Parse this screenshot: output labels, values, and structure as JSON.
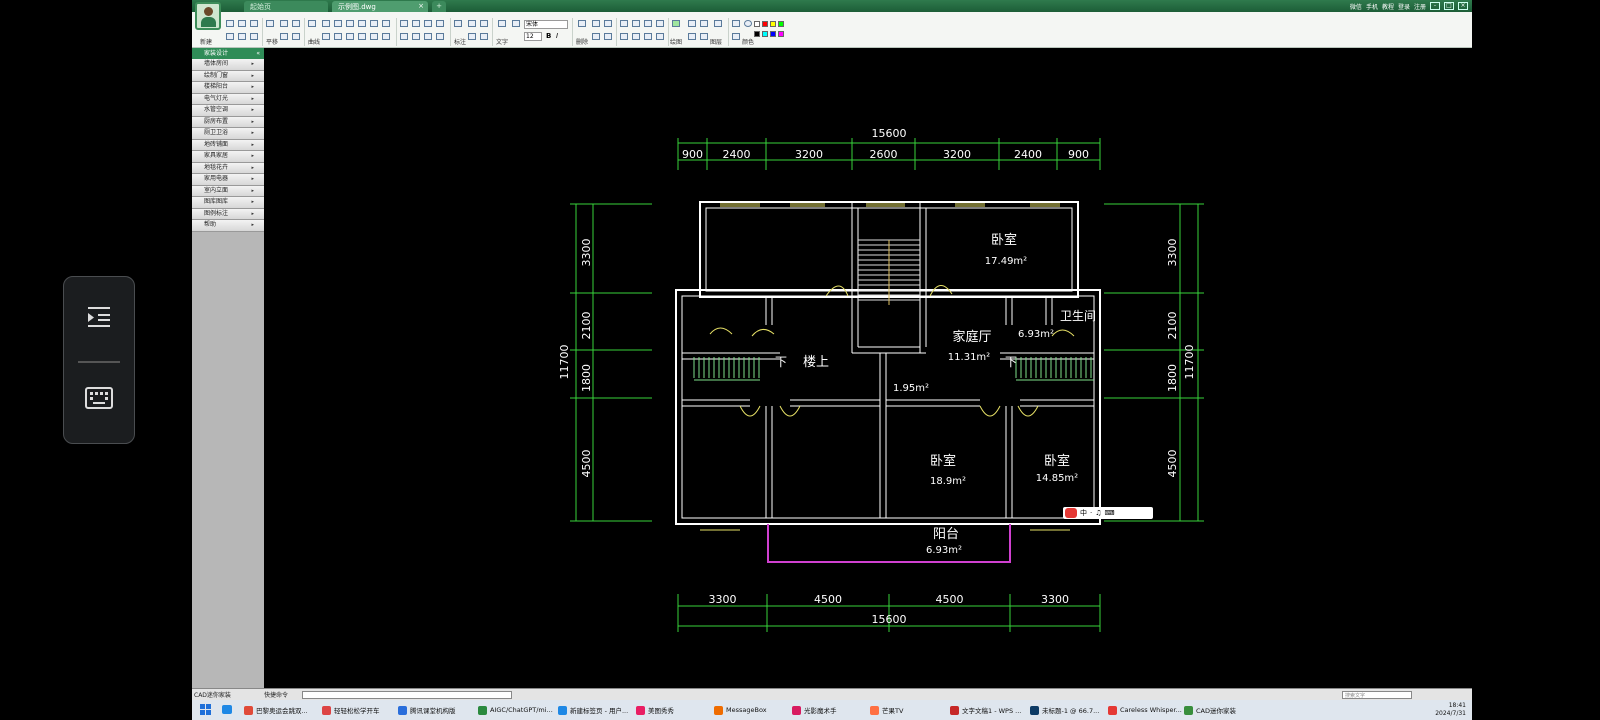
{
  "titlebar": {
    "tab_start": "起始页",
    "tab_file": "示例图.dwg",
    "tab_close": "×",
    "tab_add": "+",
    "right_items": [
      "微信",
      "手机",
      "教程",
      "登录",
      "注册"
    ],
    "win_min": "-",
    "win_max": "□",
    "win_close": "×"
  },
  "ribbon": {
    "new_label": "新建",
    "move_label": "平移",
    "curve_label": "曲线",
    "dim_label": "标注",
    "text_label": "文字",
    "erase_label": "删除",
    "draw_label": "绘图",
    "layer_label": "图层",
    "color_label": "颜色",
    "font_value": "宋体",
    "size_value": "12",
    "bold": "B",
    "italic": "I",
    "colors": [
      "#ffffff",
      "#ff0000",
      "#ffff00",
      "#00ff00",
      "#000000",
      "#00ffff",
      "#0000ff",
      "#ff00ff"
    ]
  },
  "sidebar": {
    "header": "家装设计",
    "header_collapse": "«",
    "items": [
      {
        "label": "墙体房间",
        "arrow": "▸"
      },
      {
        "label": "绘制门窗",
        "arrow": "▸"
      },
      {
        "label": "楼梯阳台",
        "arrow": "▸"
      },
      {
        "label": "电气灯光",
        "arrow": "▸"
      },
      {
        "label": "水管空调",
        "arrow": "▸"
      },
      {
        "label": "厨房布置",
        "arrow": "▸"
      },
      {
        "label": "厕卫卫浴",
        "arrow": "▸"
      },
      {
        "label": "地砖铺面",
        "arrow": "▸"
      },
      {
        "label": "家具家居",
        "arrow": "▸"
      },
      {
        "label": "地毯花卉",
        "arrow": "▸"
      },
      {
        "label": "家用电器",
        "arrow": "▸"
      },
      {
        "label": "室内立面",
        "arrow": "▸"
      },
      {
        "label": "图库图库",
        "arrow": "▸"
      },
      {
        "label": "图例标注",
        "arrow": "▸"
      },
      {
        "label": "帮助",
        "arrow": "▸"
      }
    ]
  },
  "drawing": {
    "dims_top_total": "15600",
    "dims_top": [
      "900",
      "2400",
      "3200",
      "2600",
      "3200",
      "2400",
      "900"
    ],
    "dims_bottom": [
      "3300",
      "4500",
      "4500",
      "3300"
    ],
    "dims_bottom_total": "15600",
    "dims_left_total": "11700",
    "dims_left": [
      "3300",
      "2100",
      "1800",
      "4500"
    ],
    "dims_right": [
      "3300",
      "2100",
      "1800",
      "4500"
    ],
    "dims_right_total": "11700",
    "rooms": {
      "bed_ne": "卧室",
      "bed_ne_area": "17.49m²",
      "family": "家庭厅",
      "family_area": "11.31m²",
      "bath": "卫生间",
      "bath_area": "6.93m²",
      "stair_down_left": "下",
      "stair_up": "楼上",
      "stair_down_right": "下",
      "small_area": "1.95m²",
      "bed_sc": "卧室",
      "bed_sc_area": "18.9m²",
      "bed_se": "卧室",
      "bed_se_area": "14.85m²",
      "balcony": "阳台",
      "balcony_area": "6.93m²"
    }
  },
  "cmdbar": {
    "name": "CAD迷你家装",
    "label": "快捷命令",
    "search_placeholder": "搜索文字"
  },
  "ime": {
    "items": [
      "中",
      "·",
      "♫",
      "⌨"
    ]
  },
  "taskbar": {
    "tasks": [
      {
        "label": "巴黎奥运会跳双...",
        "color": "#e04b3a"
      },
      {
        "label": "轻轻松松学开车",
        "color": "#d44"
      },
      {
        "label": "腾讯课堂机构版",
        "color": "#2a6edb"
      },
      {
        "label": "AIGC/ChatGPT/mi...",
        "color": "#2b8a3e"
      },
      {
        "label": "新建标签页 - 用户...",
        "color": "#1e88e5"
      },
      {
        "label": "美图秀秀",
        "color": "#e91e63"
      },
      {
        "label": "MessageBox",
        "color": "#ef6c00"
      },
      {
        "label": "光影魔术手",
        "color": "#d81b60"
      },
      {
        "label": "芒果TV",
        "color": "#ff7043"
      },
      {
        "label": "文字文稿1 - WPS ...",
        "color": "#c62828"
      },
      {
        "label": "未标题-1 @ 66.7...",
        "color": "#0d3b66"
      },
      {
        "label": "Careless Whisper...",
        "color": "#e53935"
      },
      {
        "label": "CAD迷你家装",
        "color": "#388e3c"
      }
    ],
    "time": "18:41",
    "date": "2024/7/31"
  }
}
